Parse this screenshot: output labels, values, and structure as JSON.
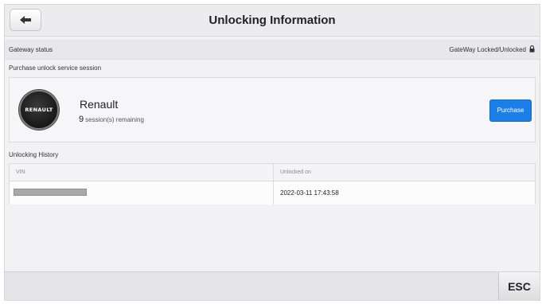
{
  "header": {
    "title": "Unlocking Information",
    "back_icon": "arrow-left-icon"
  },
  "gateway": {
    "label": "Gateway status",
    "status": "GateWay Locked/Unlocked",
    "status_icon": "lock-icon"
  },
  "purchase_section": {
    "title": "Purchase unlock service session",
    "logo_text": "RENAULT",
    "brand": "Renault",
    "session_count": "9",
    "session_suffix": "session(s) remaining",
    "purchase_label": "Purchase",
    "accent_color": "#1c7fe8"
  },
  "history": {
    "title": "Unlocking History",
    "columns": [
      "VIN",
      "Unlocked on"
    ],
    "rows": [
      {
        "vin": "",
        "unlocked_on": "2022-03-11 17:43:58"
      }
    ]
  },
  "footer": {
    "esc_label": "ESC"
  }
}
